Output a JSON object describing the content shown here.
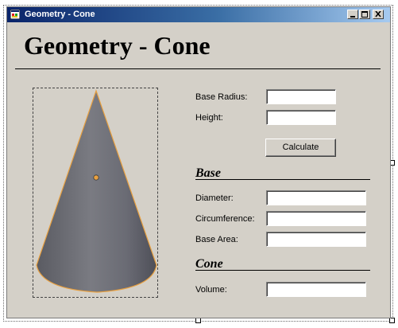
{
  "window": {
    "title": "Geometry - Cone",
    "controls": [
      "minimize-icon",
      "maximize-icon",
      "close-icon"
    ]
  },
  "heading": "Geometry - Cone",
  "inputs": {
    "base_radius_label": "Base Radius:",
    "base_radius_value": "",
    "height_label": "Height:",
    "height_value": ""
  },
  "calculate_label": "Calculate",
  "base_section": {
    "title": "Base",
    "diameter_label": "Diameter:",
    "diameter_value": "",
    "circumference_label": "Circumference:",
    "circumference_value": "",
    "area_label": "Base Area:",
    "area_value": ""
  },
  "cone_section": {
    "title": "Cone",
    "volume_label": "Volume:",
    "volume_value": ""
  },
  "colors": {
    "form_background": "#d4d0c8",
    "titlebar_start": "#0a246a",
    "titlebar_end": "#a6caf0",
    "cone_body": "#6f7078",
    "cone_outline": "#e8a040"
  }
}
